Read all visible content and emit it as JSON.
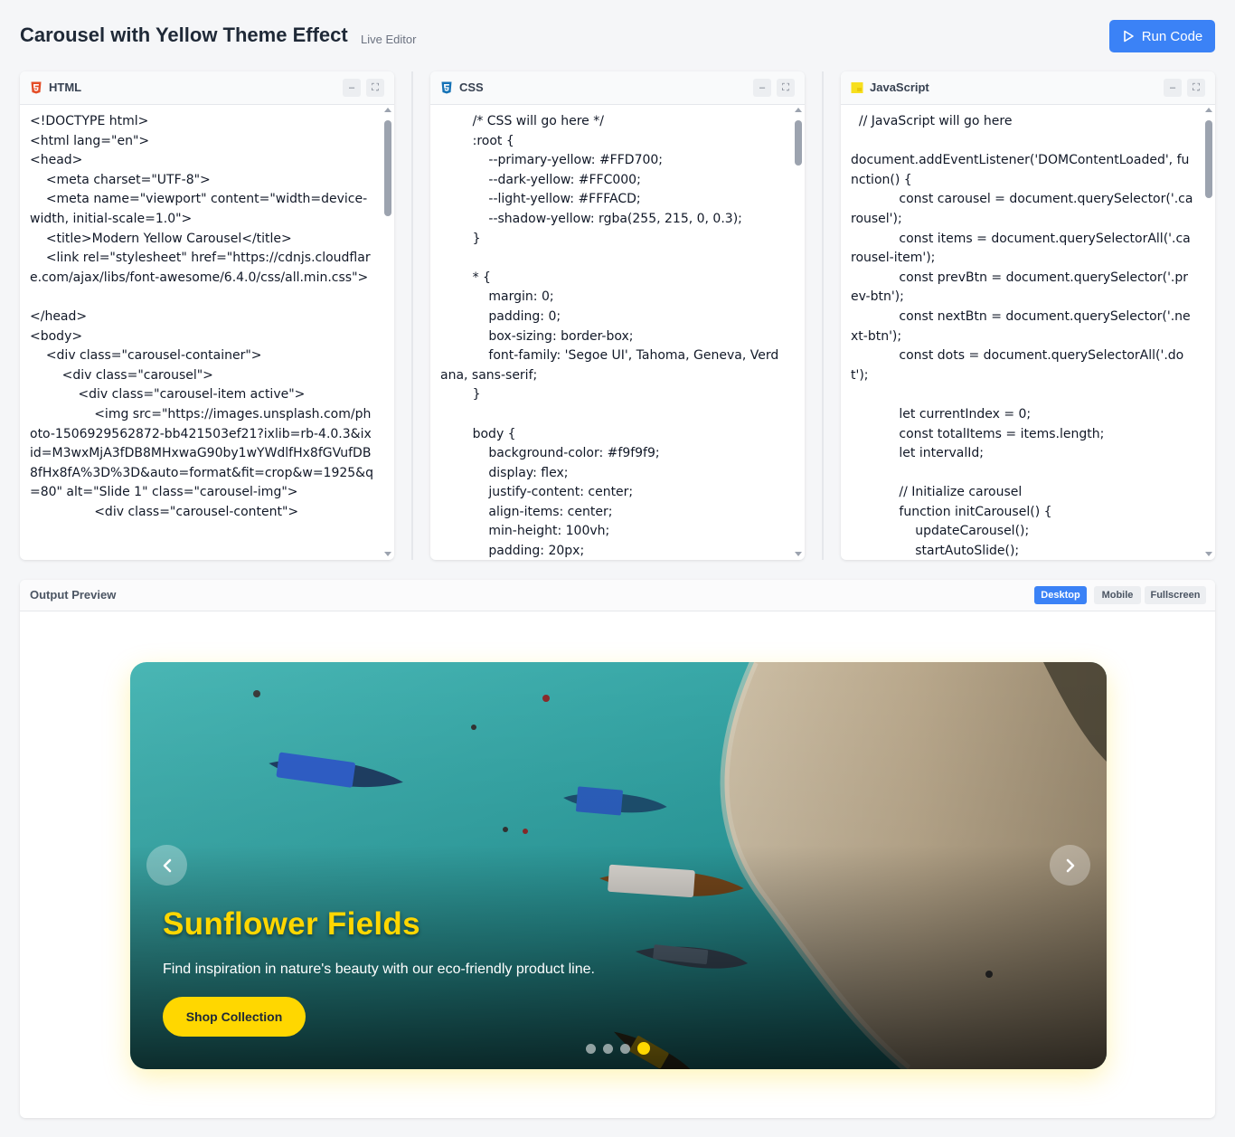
{
  "header": {
    "title": "Carousel with Yellow Theme Effect",
    "subtitle": "Live Editor",
    "run_label": "Run Code"
  },
  "panels": {
    "html": {
      "title": "HTML",
      "lines": [
        "<!DOCTYPE html>",
        "<html lang=\"en\">",
        "<head>",
        "    <meta charset=\"UTF-8\">",
        "    <meta name=\"viewport\" content=\"width=device-width, initial-scale=1.0\">",
        "    <title>Modern Yellow Carousel</title>",
        "    <link rel=\"stylesheet\" href=\"https://cdnjs.cloudflare.com/ajax/libs/font-awesome/6.4.0/css/all.min.css\">",
        "",
        "</head>",
        "<body>",
        "    <div class=\"carousel-container\">",
        "        <div class=\"carousel\">",
        "            <div class=\"carousel-item active\">",
        "                <img src=\"https://images.unsplash.com/photo-1506929562872-bb421503ef21?ixlib=rb-4.0.3&ixid=M3wxMjA3fDB8MHxwaG90by1wYWdlfHx8fGVufDB8fHx8fA%3D%3D&auto=format&fit=crop&w=1925&q=80\" alt=\"Slide 1\" class=\"carousel-img\">",
        "                <div class=\"carousel-content\">"
      ]
    },
    "css": {
      "title": "CSS",
      "lines": [
        "        /* CSS will go here */",
        "        :root {",
        "            --primary-yellow: #FFD700;",
        "            --dark-yellow: #FFC000;",
        "            --light-yellow: #FFFACD;",
        "            --shadow-yellow: rgba(255, 215, 0, 0.3);",
        "        }",
        "",
        "        * {",
        "            margin: 0;",
        "            padding: 0;",
        "            box-sizing: border-box;",
        "            font-family: 'Segoe UI', Tahoma, Geneva, Verdana, sans-serif;",
        "        }",
        "",
        "        body {",
        "            background-color: #f9f9f9;",
        "            display: flex;",
        "            justify-content: center;",
        "            align-items: center;",
        "            min-height: 100vh;",
        "            padding: 20px;"
      ]
    },
    "js": {
      "title": "JavaScript",
      "lines": [
        "  // JavaScript will go here",
        "",
        "document.addEventListener('DOMContentLoaded', function() {",
        "            const carousel = document.querySelector('.carousel');",
        "            const items = document.querySelectorAll('.carousel-item');",
        "            const prevBtn = document.querySelector('.prev-btn');",
        "            const nextBtn = document.querySelector('.next-btn');",
        "            const dots = document.querySelectorAll('.dot');",
        "",
        "            let currentIndex = 0;",
        "            const totalItems = items.length;",
        "            let intervalId;",
        "",
        "            // Initialize carousel",
        "            function initCarousel() {",
        "                updateCarousel();",
        "                startAutoSlide();",
        "            }"
      ]
    }
  },
  "output": {
    "title": "Output Preview",
    "modes": [
      "Desktop",
      "Mobile",
      "Fullscreen"
    ],
    "active_mode": "Desktop"
  },
  "carousel": {
    "slide_title": "Sunflower Fields",
    "slide_description": "Find inspiration in nature's beauty with our eco-friendly product line.",
    "button_label": "Shop Collection",
    "dot_count": 4,
    "active_dot": 3,
    "accent_color": "#FFD700"
  },
  "icons": {
    "html": "html5-icon",
    "css": "css3-icon",
    "js": "javascript-icon",
    "run": "play-icon",
    "prev": "chevron-left-icon",
    "next": "chevron-right-icon"
  }
}
